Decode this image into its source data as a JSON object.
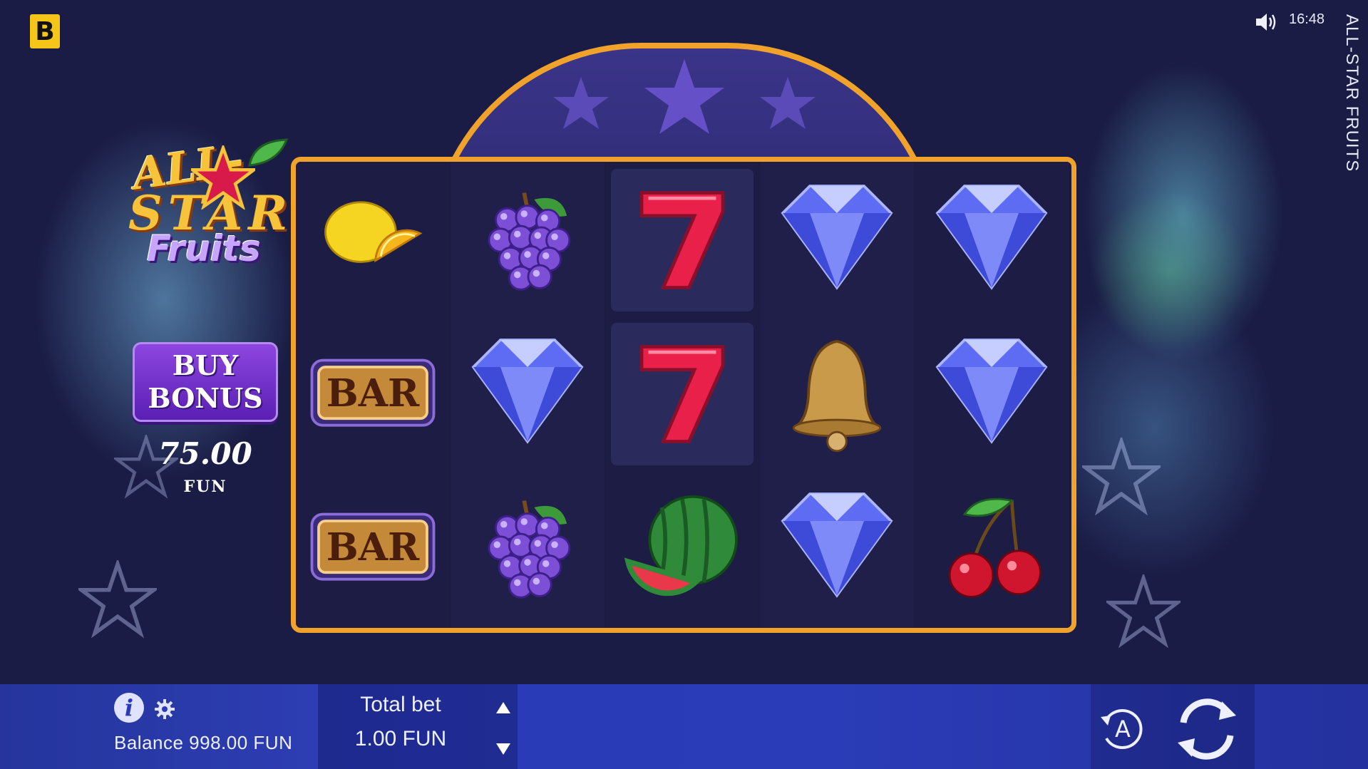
{
  "brand": {
    "logo_letter": "B"
  },
  "status": {
    "time": "16:48",
    "sound_icon": "speaker-icon"
  },
  "game": {
    "vertical_title": "ALL-STAR FRUITS",
    "logo": {
      "line1": "ALL-",
      "line2": "STAR",
      "line3": "Fruits"
    }
  },
  "buy_bonus": {
    "line1": "BUY",
    "line2": "BONUS",
    "price": "75.00",
    "currency": "FUN"
  },
  "reels": [
    [
      "lemon",
      "bar",
      "bar"
    ],
    [
      "grapes",
      "diamond",
      "grapes"
    ],
    [
      "seven",
      "seven",
      "watermelon"
    ],
    [
      "diamond",
      "bell",
      "diamond"
    ],
    [
      "diamond",
      "diamond",
      "cherry"
    ]
  ],
  "bottom_bar": {
    "balance": "Balance 998.00 FUN",
    "total_bet_label": "Total bet",
    "total_bet_value": "1.00 FUN",
    "info_label": "i"
  },
  "colors": {
    "frame": "#f0a22b",
    "buy_bonus": "#7a36d4",
    "bar_bg": "#2a3ab8"
  }
}
